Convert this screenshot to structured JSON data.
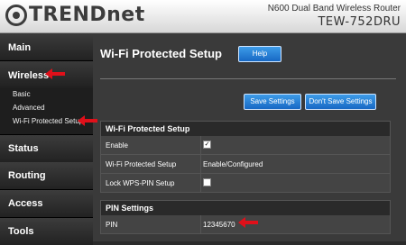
{
  "brand": {
    "name": "TRENDnet"
  },
  "model": {
    "description": "N600 Dual Band Wireless Router",
    "name": "TEW-752DRU"
  },
  "sidebar": {
    "main": "Main",
    "wireless": "Wireless",
    "wireless_sub": [
      "Basic",
      "Advanced",
      "Wi-Fi Protected Setup"
    ],
    "status": "Status",
    "routing": "Routing",
    "access": "Access",
    "tools": "Tools"
  },
  "page": {
    "title": "Wi-Fi Protected Setup",
    "help_label": "Help"
  },
  "actions": {
    "save_label": "Save Settings",
    "dont_save_label": "Don't Save Settings"
  },
  "wps_section": {
    "title": "Wi-Fi Protected Setup",
    "enable_label": "Enable",
    "enable_checked": true,
    "status_label": "Wi-Fi Protected Setup",
    "status_value": "Enable/Configured",
    "lock_label": "Lock WPS-PIN Setup",
    "lock_checked": false
  },
  "pin_section": {
    "title": "PIN Settings",
    "pin_label": "PIN",
    "pin_value": "12345670"
  },
  "colors": {
    "accent_button": "#1f7fd6",
    "annotation_arrow": "#e0101a"
  }
}
